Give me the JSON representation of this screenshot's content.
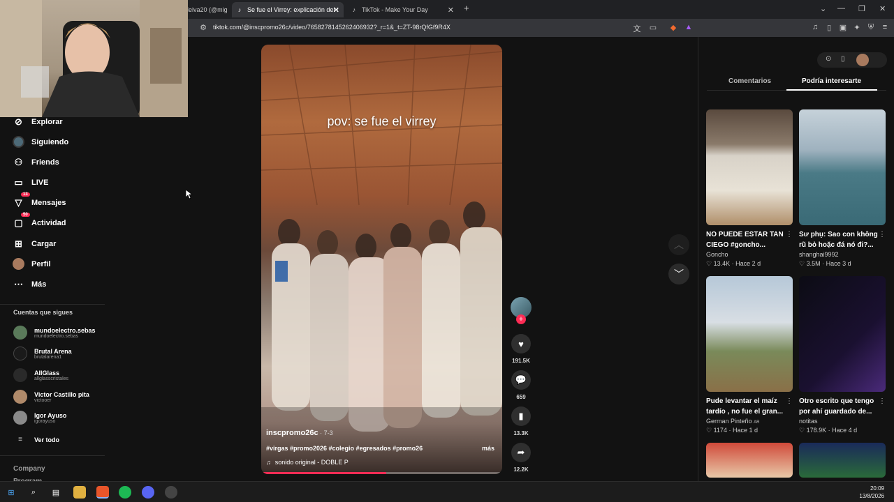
{
  "browser": {
    "tabs": [
      {
        "label": "leiva20 (@mig",
        "active": false
      },
      {
        "label": "Se fue el Virrey: explicación del t",
        "active": true
      },
      {
        "label": "TikTok - Make Your Day",
        "active": false
      }
    ],
    "url": "tiktok.com/@inscpromo26c/video/7658278145262406932?_r=1&_t=ZT-98rQfGf9R4X"
  },
  "sidebar": {
    "nav": [
      {
        "label": "Explorar",
        "icon": "compass-icon"
      },
      {
        "label": "Siguiendo",
        "icon": "following-avatar-icon"
      },
      {
        "label": "Friends",
        "icon": "friends-icon"
      },
      {
        "label": "LIVE",
        "icon": "live-icon"
      },
      {
        "label": "Mensajes",
        "icon": "messages-icon",
        "badge": "13"
      },
      {
        "label": "Actividad",
        "icon": "activity-icon",
        "badge": "50"
      },
      {
        "label": "Cargar",
        "icon": "upload-icon"
      },
      {
        "label": "Perfil",
        "icon": "profile-avatar-icon"
      },
      {
        "label": "Más",
        "icon": "more-icon"
      }
    ],
    "following_title": "Cuentas que sigues",
    "accounts": [
      {
        "name": "mundoelectro.sebas",
        "handle": "mundoelectro.sebas"
      },
      {
        "name": "Brutal Arena",
        "handle": "brutalarena1"
      },
      {
        "name": "AllGlass",
        "handle": "allglasscristales"
      },
      {
        "name": "Victor Castillo pita",
        "handle": "victooer"
      },
      {
        "name": "Igor Ayuso",
        "handle": "igorayuso"
      }
    ],
    "see_all": "Ver todo",
    "footer": "Company",
    "footer2": "Program"
  },
  "video": {
    "overlay_text": "pov: se fue el virrey",
    "author": "inscpromo26c",
    "date": " · 7-3",
    "hashtags": "#virgas #promo2026 #colegio #egresados #promo26",
    "more": "más",
    "sound": "sonido original - DOBLE P",
    "progress": 0.52
  },
  "actions": {
    "likes": "191.5K",
    "comments": "659",
    "saves": "13.3K",
    "shares": "12.2K"
  },
  "right_panel": {
    "tabs": [
      "Comentarios",
      "Podría interesarte"
    ],
    "active_tab": 1,
    "cards": [
      {
        "title": "NO PUEDE ESTAR TAN CIEGO #goncho...",
        "author": "Goncho",
        "likes": "13.4K",
        "age": "Hace 2 d"
      },
      {
        "title": "Sư phụ: Sao con không rũ bỏ hoặc đá nó đi?...",
        "author": "shanghai9992",
        "likes": "3.5M",
        "age": "Hace 3 d"
      },
      {
        "title": "Pude levantar el maíz tardío , no fue el gran...",
        "author": "German Pinteño",
        "author_badge": "AR",
        "likes": "1174",
        "age": "Hace 1 d"
      },
      {
        "title": "Otro escrito que tengo por ahí guardado de...",
        "author": "notitas",
        "likes": "178.9K",
        "age": "Hace 4 d"
      }
    ]
  },
  "taskbar": {
    "time": "20:09",
    "date": "13/8/2026"
  },
  "colors": {
    "accent": "#fe2c55",
    "background": "#121212"
  }
}
